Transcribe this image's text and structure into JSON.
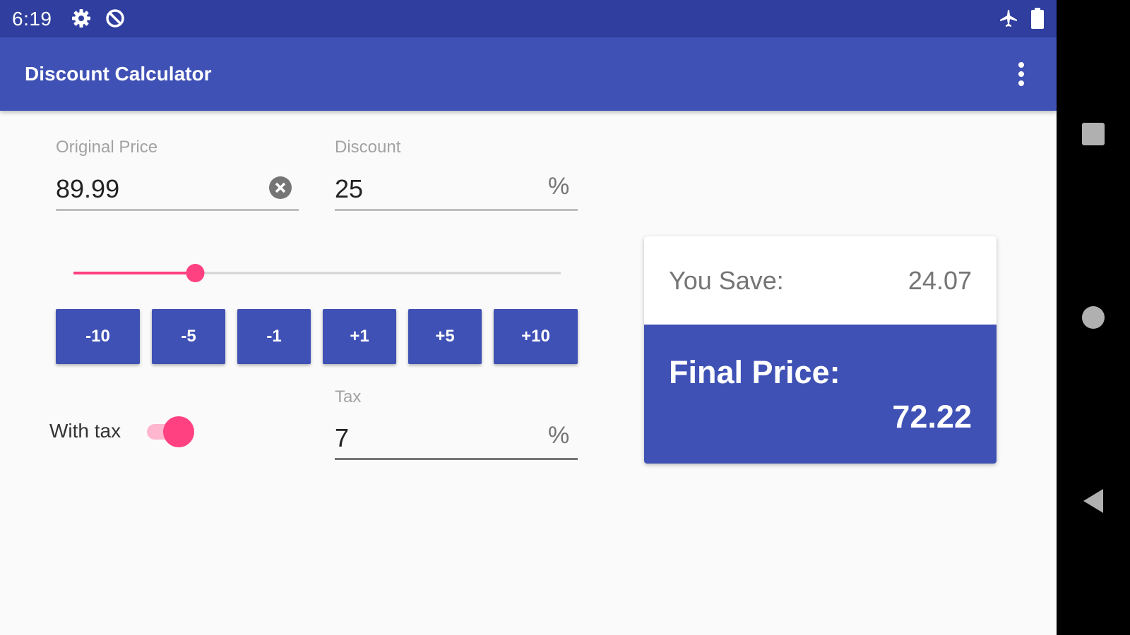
{
  "status_bar": {
    "time": "6:19",
    "icons": [
      "gear-icon",
      "sync-disabled-icon",
      "airplane-icon",
      "battery-icon"
    ]
  },
  "app_bar": {
    "title": "Discount Calculator",
    "menu_icon": "more-vert-icon"
  },
  "form": {
    "original_price": {
      "label": "Original Price",
      "value": "89.99",
      "clear_icon": "clear-circle-icon"
    },
    "discount": {
      "label": "Discount",
      "value": "25",
      "suffix": "%"
    },
    "discount_slider": {
      "value": 25,
      "min": 0,
      "max": 100
    },
    "step_buttons": [
      "-10",
      "-5",
      "-1",
      "+1",
      "+5",
      "+10"
    ],
    "with_tax": {
      "label": "With tax",
      "checked": true
    },
    "tax": {
      "label": "Tax",
      "value": "7",
      "suffix": "%"
    }
  },
  "result": {
    "save_label": "You Save:",
    "save_value": "24.07",
    "final_label": "Final Price:",
    "final_value": "72.22"
  },
  "nav_bar": {
    "icons": [
      "recents-square-icon",
      "home-circle-icon",
      "back-triangle-icon"
    ]
  },
  "colors": {
    "status_bar": "#303f9f",
    "primary": "#3f51b5",
    "accent": "#ff4081",
    "background": "#fafafa"
  }
}
